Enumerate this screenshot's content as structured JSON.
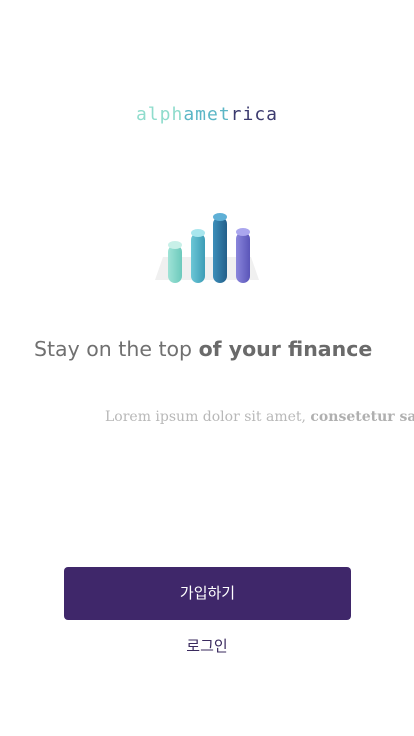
{
  "logo": {
    "part1": "alph",
    "part2": "amet",
    "part3": "rica",
    "colors": [
      "#8fdccc",
      "#5bb6c6",
      "#3b3a6e"
    ]
  },
  "illustration": {
    "icon": "bar-chart-icon",
    "bar_colors": [
      "#84d8cc",
      "#4fb0c6",
      "#2e78a0",
      "#6a66c6"
    ]
  },
  "headline": {
    "regular": "Stay on the top ",
    "bold": "of your finance"
  },
  "subtext": {
    "regular": "Lorem ipsum dolor sit amet, ",
    "bold": "consetetur sadip"
  },
  "buttons": {
    "signup_label": "가입하기",
    "login_label": "로그인"
  }
}
